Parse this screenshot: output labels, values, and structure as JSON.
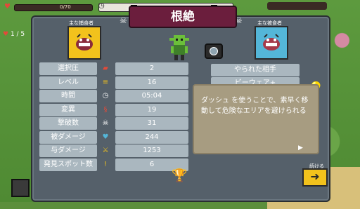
{
  "hud": {
    "hp_text": "0/70",
    "lives_text": "1 / 5"
  },
  "title": "根絶",
  "cards": {
    "left_label": "主な捕食者",
    "right_label": "主な被食者"
  },
  "stats": [
    {
      "label": "選択圧",
      "value": "2",
      "icon": "pressure-icon"
    },
    {
      "label": "レベル",
      "value": "16",
      "icon": "level-icon"
    },
    {
      "label": "時間",
      "value": "05:04",
      "icon": "clock-icon"
    },
    {
      "label": "変異",
      "value": "19",
      "icon": "dna-icon"
    },
    {
      "label": "撃破数",
      "value": "31",
      "icon": "skull-icon"
    },
    {
      "label": "被ダメージ",
      "value": "244",
      "icon": "heart-icon"
    },
    {
      "label": "与ダメージ",
      "value": "1253",
      "icon": "sword-icon"
    },
    {
      "label": "発見スポット数",
      "value": "6",
      "icon": "exclamation-icon"
    }
  ],
  "right_buttons": {
    "killed_by": "やられた相手",
    "build_name": "ビーウェア+"
  },
  "description": "ダッシュ を使うことで、素早く移動して危険なエリアを避けられる",
  "continue_label": "続ける",
  "colors": {
    "title_bg": "#6b1e3d",
    "panel_bg": "#55606a",
    "cell_bg": "#aab7bf",
    "accent_yellow": "#f2c21c",
    "accent_blue": "#54b6d8"
  }
}
